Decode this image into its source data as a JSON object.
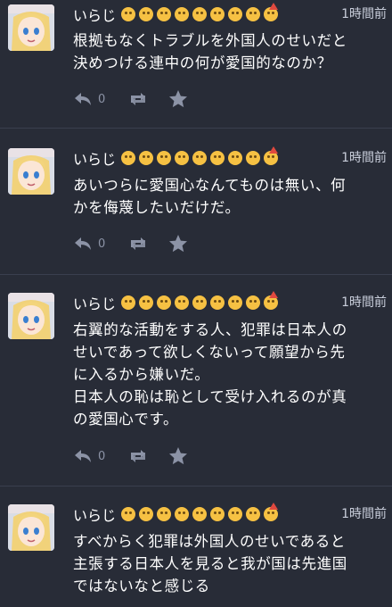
{
  "statuses": [
    {
      "display_name": "いらじ",
      "emojis": [
        "kissing-face-emoji",
        "woozy-face-emoji",
        "face-with-rolling-eyes-emoji",
        "worried-face-emoji",
        "thinking-face-emoji",
        "grinning-face-emoji",
        "hugging-face-emoji",
        "zany-face-emoji",
        "partying-face-emoji"
      ],
      "time": "1時間前",
      "lines": [
        "根拠もなくトラブルを外国人のせいだと",
        "決めつける連中の何が愛国的なのか？"
      ],
      "reply_count": "0"
    },
    {
      "display_name": "いらじ",
      "emojis": [
        "kissing-face-emoji",
        "woozy-face-emoji",
        "face-with-rolling-eyes-emoji",
        "worried-face-emoji",
        "thinking-face-emoji",
        "grinning-face-emoji",
        "hugging-face-emoji",
        "zany-face-emoji",
        "partying-face-emoji"
      ],
      "time": "1時間前",
      "lines": [
        "あいつらに愛国心なんてものは無い、何",
        "かを侮蔑したいだけだ。"
      ],
      "reply_count": "0"
    },
    {
      "display_name": "いらじ",
      "emojis": [
        "kissing-face-emoji",
        "woozy-face-emoji",
        "face-with-rolling-eyes-emoji",
        "worried-face-emoji",
        "thinking-face-emoji",
        "grinning-face-emoji",
        "hugging-face-emoji",
        "zany-face-emoji",
        "partying-face-emoji"
      ],
      "time": "1時間前",
      "lines": [
        "右翼的な活動をする人、犯罪は日本人の",
        "せいであって欲しくないって願望から先",
        "に入るから嫌いだ。",
        "日本人の恥は恥として受け入れるのが真",
        "の愛国心です。"
      ],
      "reply_count": "0"
    },
    {
      "display_name": "いらじ",
      "emojis": [
        "kissing-face-emoji",
        "woozy-face-emoji",
        "face-with-rolling-eyes-emoji",
        "worried-face-emoji",
        "thinking-face-emoji",
        "grinning-face-emoji",
        "hugging-face-emoji",
        "zany-face-emoji",
        "partying-face-emoji"
      ],
      "time": "1時間前",
      "lines": [
        "すべからく犯罪は外国人のせいであると",
        "主張する日本人を見ると我が国は先進国",
        "ではないなと感じる"
      ],
      "reply_count": ""
    }
  ],
  "colors": {
    "background": "#282c37",
    "text": "#ffffff",
    "muted": "#8c93a6",
    "divider": "#3a3f4e"
  },
  "icons": {
    "reply": "reply-icon",
    "reblog": "retweet-icon",
    "favourite": "star-icon"
  }
}
